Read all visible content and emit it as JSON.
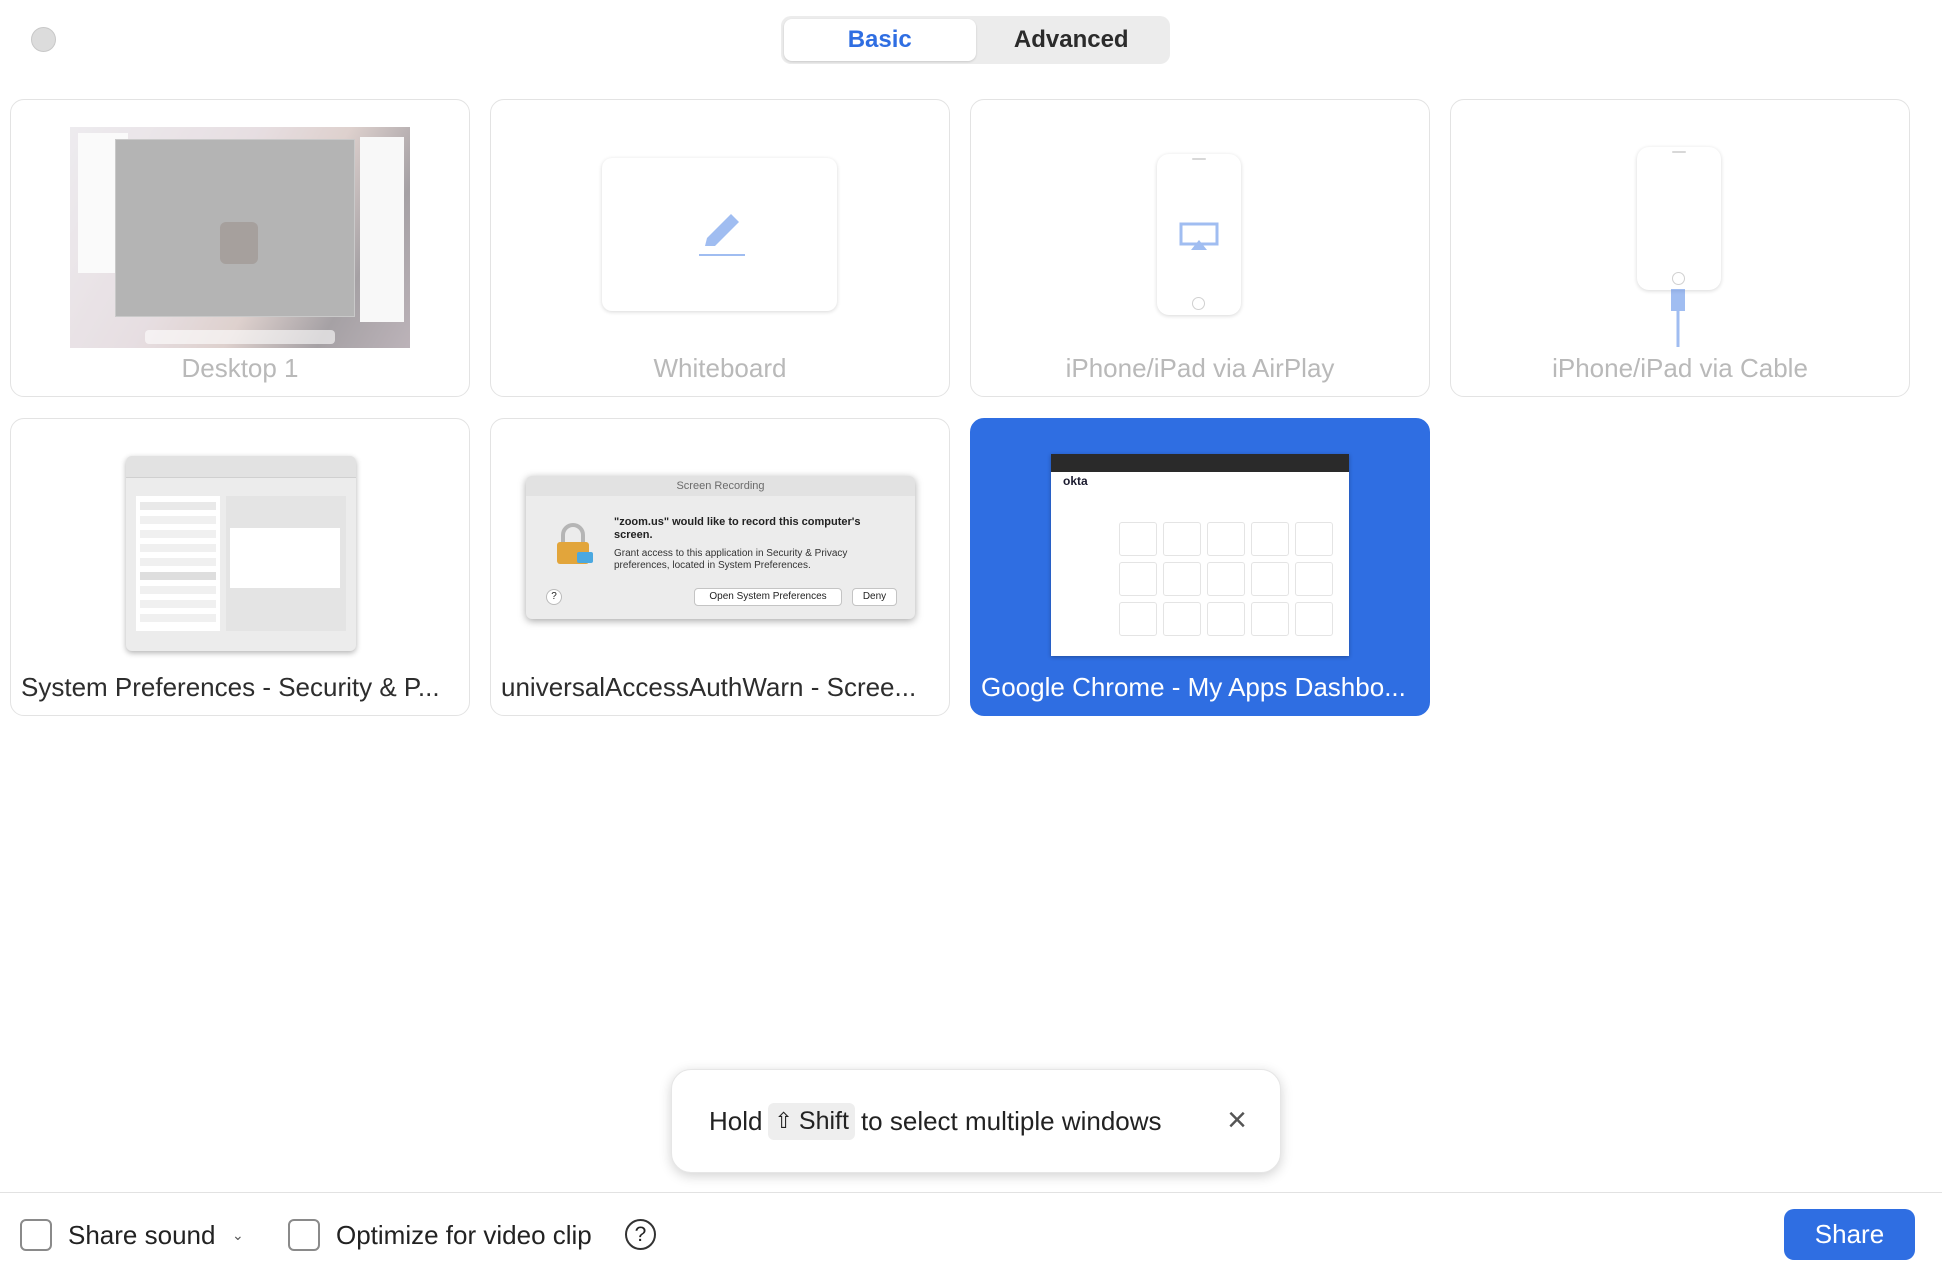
{
  "tabs": [
    {
      "label": "Basic",
      "active": true
    },
    {
      "label": "Advanced",
      "active": false
    }
  ],
  "sources": [
    {
      "label": "Desktop 1",
      "icon": "desktop-thumbnail",
      "enabled": false
    },
    {
      "label": "Whiteboard",
      "icon": "pencil-icon",
      "enabled": false
    },
    {
      "label": "iPhone/iPad via AirPlay",
      "icon": "airplay-icon",
      "enabled": false
    },
    {
      "label": "iPhone/iPad via Cable",
      "icon": "cable-icon",
      "enabled": false
    }
  ],
  "windows": [
    {
      "label": "System Preferences - Security & P...",
      "selected": false
    },
    {
      "label": "universalAccessAuthWarn - Scree...",
      "selected": false
    },
    {
      "label": "Google Chrome - My Apps Dashbo...",
      "selected": true
    }
  ],
  "dialog_thumb": {
    "title": "Screen Recording",
    "heading": "\"zoom.us\" would like to record this computer's screen.",
    "body": "Grant access to this application in Security & Privacy preferences, located in System Preferences.",
    "open_button": "Open System Preferences",
    "deny_button": "Deny",
    "help": "?"
  },
  "chrome_thumb": {
    "logo": "okta"
  },
  "tooltip": {
    "prefix": "Hold",
    "key_icon": "⇧",
    "key": "Shift",
    "suffix": "to select multiple windows"
  },
  "footer": {
    "share_sound_label": "Share sound",
    "optimize_label": "Optimize for video clip",
    "help": "?",
    "share_button": "Share"
  },
  "colors": {
    "accent": "#2f6ee2"
  }
}
